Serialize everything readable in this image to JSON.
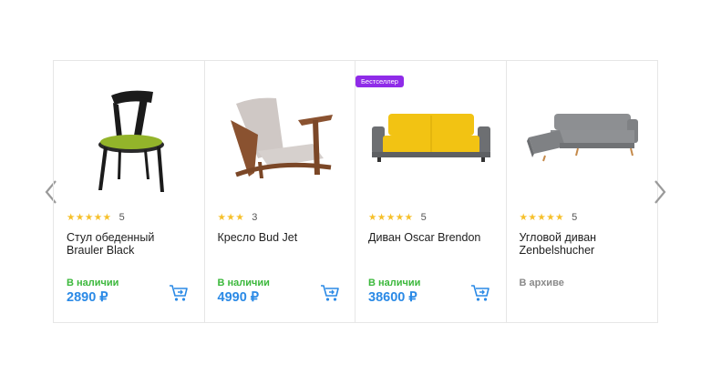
{
  "nav": {
    "prev_icon": "chevron-left-icon",
    "next_icon": "chevron-right-icon"
  },
  "colors": {
    "in_stock": "#3cb83c",
    "price": "#2b8ae6",
    "badge": "#8f2be8",
    "star": "#f6c02a",
    "archive": "#8a8a8a"
  },
  "products": [
    {
      "name": "Стул обеденный Brauler Black",
      "stars": "★★★★★",
      "rating": 5,
      "rating_text": "5",
      "status": "В наличии",
      "price": "2890 ₽",
      "badge": "",
      "image": "dining-chair-image",
      "cart_icon": "cart-icon"
    },
    {
      "name": "Кресло Bud Jet",
      "stars": "★★★",
      "rating": 3,
      "rating_text": "3",
      "status": "В наличии",
      "price": "4990 ₽",
      "badge": "",
      "image": "armchair-image",
      "cart_icon": "cart-icon"
    },
    {
      "name": "Диван Oscar Brendon",
      "stars": "★★★★★",
      "rating": 5,
      "rating_text": "5",
      "status": "В наличии",
      "price": "38600 ₽",
      "badge": "Бестселлер",
      "image": "sofa-image",
      "cart_icon": "cart-icon"
    },
    {
      "name": "Угловой диван Zenbelshucher",
      "stars": "★★★★★",
      "rating": 5,
      "rating_text": "5",
      "status": "В архиве",
      "price": "",
      "badge": "",
      "image": "corner-sofa-image"
    }
  ]
}
